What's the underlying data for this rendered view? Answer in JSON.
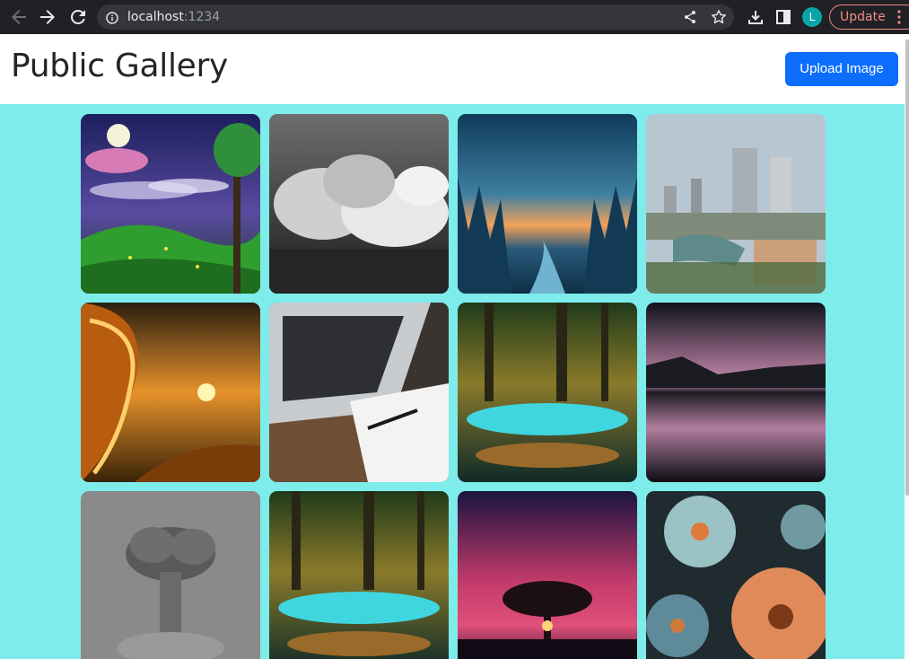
{
  "browser": {
    "url_host": "localhost",
    "url_port": ":1234",
    "profile_initial": "L",
    "update_label": "Update"
  },
  "header": {
    "title": "Public Gallery",
    "upload_label": "Upload Image"
  },
  "gallery": {
    "images": [
      "night-fantasy-meadow",
      "black-white-clouds",
      "forest-valley-sunset",
      "city-skyline-aerial",
      "golden-wave-sunset",
      "laptop-notebook-desk",
      "enchanted-forest-stream",
      "pink-dusk-lake",
      "grayscale-smoke-cloud",
      "enchanted-forest-stream-2",
      "tree-pink-sky",
      "coral-blue-flowers"
    ]
  },
  "colors": {
    "page_bg": "#7eeceb",
    "primary": "#0d6efd",
    "chrome": "#202124"
  }
}
